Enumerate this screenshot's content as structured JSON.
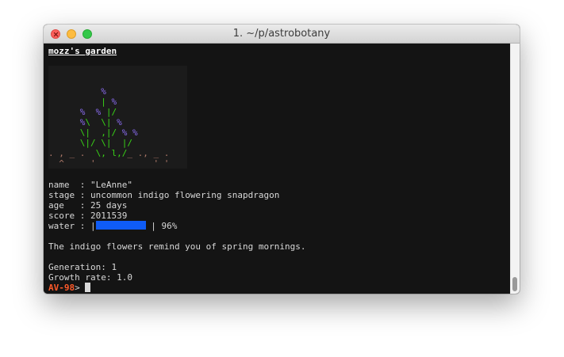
{
  "window": {
    "title": "1. ~/p/astrobotany"
  },
  "terminal": {
    "heading": "mozz's garden",
    "plant_art": {
      "rows": [
        [
          {
            "t": "          "
          },
          {
            "t": "%",
            "c": "p"
          }
        ],
        [
          {
            "t": "          "
          },
          {
            "t": "|",
            "c": "g"
          },
          {
            "t": " "
          },
          {
            "t": "%",
            "c": "p"
          }
        ],
        [
          {
            "t": "      "
          },
          {
            "t": "%",
            "c": "p"
          },
          {
            "t": "  "
          },
          {
            "t": "%",
            "c": "p"
          },
          {
            "t": " "
          },
          {
            "t": "|/",
            "c": "g"
          }
        ],
        [
          {
            "t": "      "
          },
          {
            "t": "%",
            "c": "p"
          },
          {
            "t": "\\",
            "c": "g"
          },
          {
            "t": "  "
          },
          {
            "t": "\\|",
            "c": "g"
          },
          {
            "t": " "
          },
          {
            "t": "%",
            "c": "p"
          }
        ],
        [
          {
            "t": "      "
          },
          {
            "t": "\\|",
            "c": "g"
          },
          {
            "t": "  "
          },
          {
            "t": ",|/",
            "c": "g"
          },
          {
            "t": " "
          },
          {
            "t": "%",
            "c": "p"
          },
          {
            "t": " "
          },
          {
            "t": "%",
            "c": "p"
          }
        ],
        [
          {
            "t": "      "
          },
          {
            "t": "\\|/",
            "c": "g"
          },
          {
            "t": " "
          },
          {
            "t": "\\|",
            "c": "g"
          },
          {
            "t": "  "
          },
          {
            "t": "|/",
            "c": "g"
          }
        ],
        [
          {
            "t": ". , _ .  ",
            "c": "soil"
          },
          {
            "t": "\\, l,/",
            "c": "g"
          },
          {
            "t": "_ ., _ .",
            "c": "soil"
          }
        ],
        [
          {
            "t": "  ^     '           ' '",
            "c": "soil"
          }
        ]
      ]
    },
    "info": {
      "name_label": "name  : ",
      "name_value": "\"LeAnne\"",
      "stage_label": "stage : ",
      "stage_value": "uncommon indigo flowering snapdragon",
      "age_label": "age   : ",
      "age_value": "25 days",
      "score_label": "score : ",
      "score_value": "2011539",
      "water_label": "water : |",
      "water_level": 0.96,
      "water_suffix": " | 96%"
    },
    "description": "The indigo flowers remind you of spring mornings.",
    "generation": "Generation: 1",
    "growth_rate": "Growth rate: 1.0",
    "prompt": "AV-98",
    "prompt_symbol": ">"
  },
  "colors": {
    "background": "#141414",
    "stem": "#39d417",
    "flower": "#8a6cf0",
    "soil": "#b07a6a",
    "water_bar": "#0f5cf6",
    "prompt": "#ff5a2a"
  }
}
